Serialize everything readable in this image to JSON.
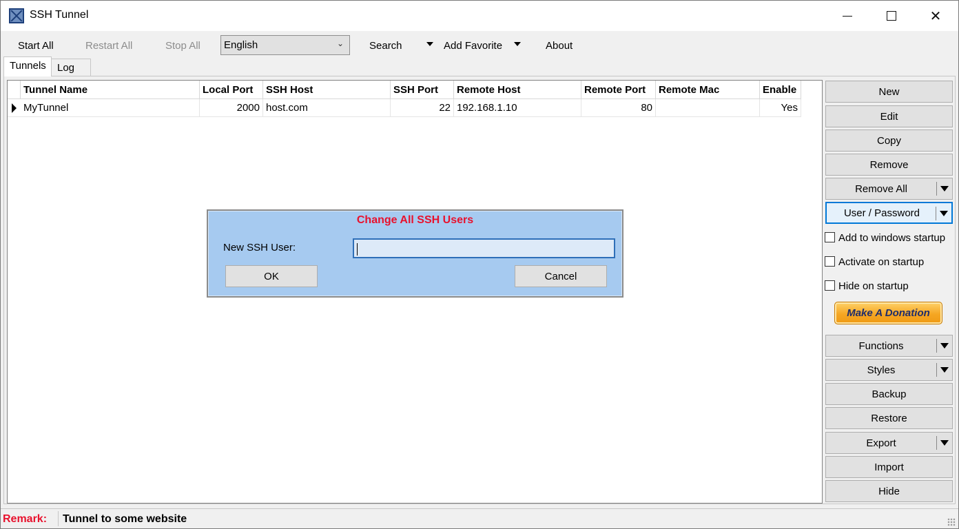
{
  "window": {
    "title": "SSH Tunnel",
    "controls": {
      "minimize": "minimize",
      "maximize": "maximize",
      "close": "✕"
    }
  },
  "toolbar": {
    "start_all": "Start All",
    "restart_all": "Restart All",
    "stop_all": "Stop All",
    "language_selected": "English",
    "search": "Search",
    "add_favorite": "Add Favorite",
    "about": "About"
  },
  "tabs": [
    {
      "label": "Tunnels",
      "active": true
    },
    {
      "label": "Log",
      "active": false
    }
  ],
  "table": {
    "columns": [
      "Tunnel Name",
      "Local Port",
      "SSH Host",
      "SSH Port",
      "Remote Host",
      "Remote Port",
      "Remote Mac",
      "Enable"
    ],
    "rows": [
      {
        "tunnel_name": "MyTunnel",
        "local_port": "2000",
        "ssh_host": "host.com",
        "ssh_port": "22",
        "remote_host": "192.168.1.10",
        "remote_port": "80",
        "remote_mac": "",
        "enable": "Yes"
      }
    ]
  },
  "side_buttons": {
    "new": "New",
    "edit": "Edit",
    "copy": "Copy",
    "remove": "Remove",
    "remove_all": "Remove All",
    "user_password": "User / Password",
    "functions": "Functions",
    "styles": "Styles",
    "backup": "Backup",
    "restore": "Restore",
    "export": "Export",
    "import": "Import",
    "hide": "Hide"
  },
  "checkboxes": {
    "add_startup": "Add to windows startup",
    "activate_startup": "Activate on startup",
    "hide_startup": "Hide on startup"
  },
  "donation": {
    "label": "Make A Donation"
  },
  "dialog": {
    "title": "Change All SSH Users",
    "field_label": "New SSH User:",
    "field_value": "",
    "ok": "OK",
    "cancel": "Cancel"
  },
  "status": {
    "remark_label": "Remark:",
    "remark_text": "Tunnel to some website"
  },
  "colors": {
    "dialog_bg": "#a6caf0",
    "title_red": "#e8112d",
    "focus_blue": "#0078d7",
    "donate_orange": "#f5a623"
  }
}
